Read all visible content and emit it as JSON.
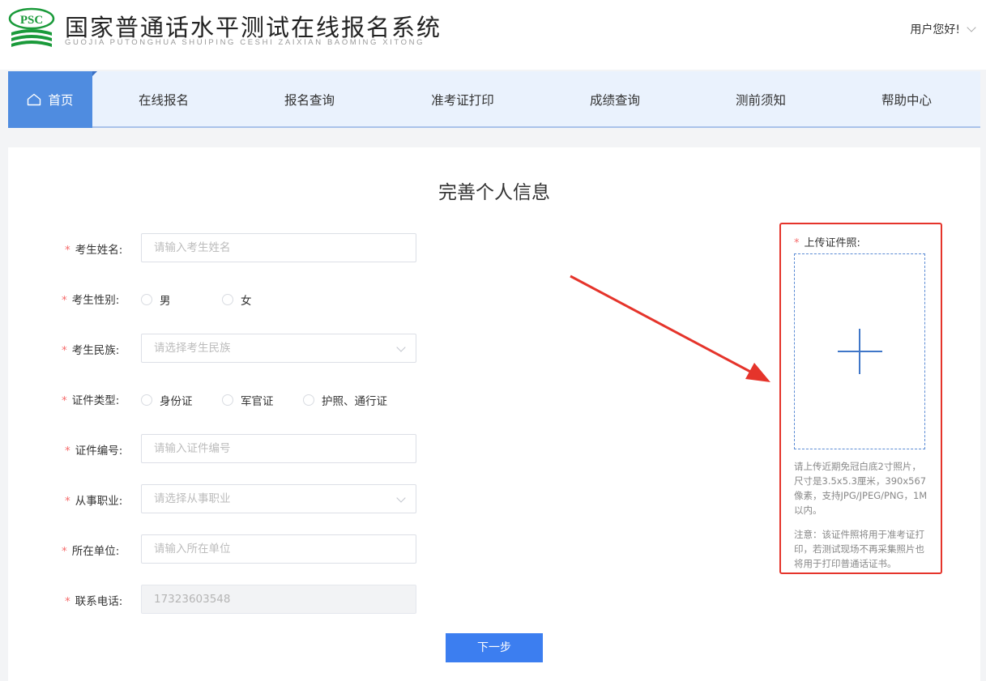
{
  "header": {
    "logo_text": "PSC",
    "title": "国家普通话水平测试在线报名系统",
    "subtitle": "GUOJIA PUTONGHUA SHUIPING CESHI ZAIXIAN BAOMING XITONG",
    "user_greeting": "用户您好!"
  },
  "nav": {
    "home": "首页",
    "items": [
      "在线报名",
      "报名查询",
      "准考证打印",
      "成绩查询",
      "测前须知",
      "帮助中心"
    ]
  },
  "form": {
    "title": "完善个人信息",
    "required_mark": "*",
    "name": {
      "label": "考生姓名:",
      "placeholder": "请输入考生姓名"
    },
    "gender": {
      "label": "考生性别:",
      "options": [
        "男",
        "女"
      ]
    },
    "ethnicity": {
      "label": "考生民族:",
      "placeholder": "请选择考生民族"
    },
    "id_type": {
      "label": "证件类型:",
      "options": [
        "身份证",
        "军官证",
        "护照、通行证"
      ]
    },
    "id_number": {
      "label": "证件编号:",
      "placeholder": "请输入证件编号"
    },
    "occupation": {
      "label": "从事职业:",
      "placeholder": "请选择从事职业"
    },
    "employer": {
      "label": "所在单位:",
      "placeholder": "请输入所在单位"
    },
    "phone": {
      "label": "联系电话:",
      "value": "17323603548"
    },
    "next_button": "下一步"
  },
  "photo": {
    "label": "上传证件照:",
    "tip": "请上传近期免冠白底2寸照片，尺寸是3.5x5.3厘米，390x567像素，支持JPG/JPEG/PNG，1M以内。",
    "note": "注意：该证件照将用于准考证打印，若测试现场不再采集照片也将用于打印普通话证书。"
  },
  "colors": {
    "nav_active": "#4f8ce0",
    "nav_bg": "#eaf2fd",
    "primary_button": "#3c7ef0",
    "highlight_red": "#e5342b",
    "required_red": "#f56c6c",
    "logo_green": "#1a9a3a"
  }
}
